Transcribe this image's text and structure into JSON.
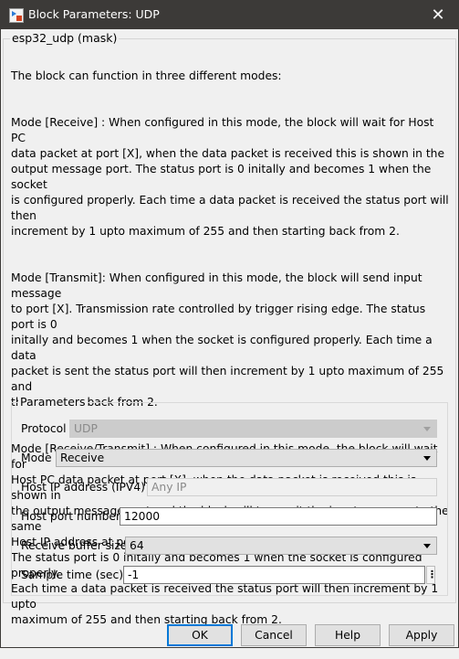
{
  "window": {
    "title": "Block Parameters: UDP"
  },
  "mask": {
    "legend": "esp32_udp (mask)",
    "paragraphs": [
      "The block can function in three different modes:",
      "Mode [Receive] : When configured in this mode, the block will wait for Host PC\ndata packet at port [X], when the data packet is received this is shown in the\noutput message port. The status port is 0 initally and becomes 1 when the socket\nis configured properly. Each time a data packet is received the status port will then\nincrement by 1 upto maximum of 255 and then starting back from 2.",
      "Mode [Transmit]: When configured in this mode, the block will send input message\nto port [X]. Transmission rate controlled by trigger rising edge. The status port is 0\ninitally and becomes 1 when the socket is configured properly. Each time a data\npacket is sent the status port will then increment by 1 upto maximum of 255 and\nthen starting back from 2.",
      "Mode [Receive/Transmit] : When configured in this mode, the block will wait for\nHost PC data packet at port [X], when the data packet is received this is shown in\nthe output message port and the block will transmit the input message to the same\nHost IP address at port [X+1].\nThe status port is 0 initally and becomes 1 when the socket is configured properly.\nEach time a data packet is received the status port will then increment by 1 upto\nmaximum of 255 and then starting back from 2."
    ]
  },
  "parameters": {
    "legend": "Parameters",
    "protocol": {
      "label": "Protocol",
      "value": "UDP"
    },
    "mode": {
      "label": "Mode",
      "value": "Receive"
    },
    "host_ip": {
      "label": "Host IP address (IPV4)",
      "value": "Any IP"
    },
    "host_port": {
      "label": "Host port number",
      "value": "12000"
    },
    "buffer": {
      "label": "Receive buffer size",
      "value": "64"
    },
    "sample_time": {
      "label": "Sample time (sec)",
      "value": "-1"
    },
    "ellipsis": "⋮"
  },
  "buttons": {
    "ok": "OK",
    "cancel": "Cancel",
    "help": "Help",
    "apply": "Apply"
  }
}
